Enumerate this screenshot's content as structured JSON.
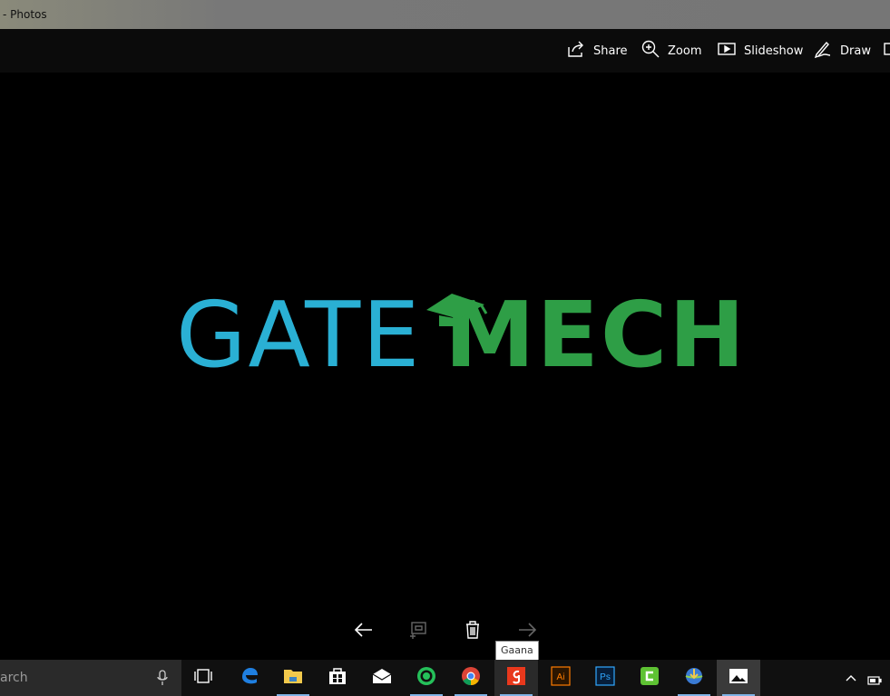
{
  "window": {
    "title": "- Photos"
  },
  "toolbar": {
    "share_label": "Share",
    "zoom_label": "Zoom",
    "slideshow_label": "Slideshow",
    "draw_label": "Draw"
  },
  "image": {
    "logo_left": "GATE",
    "logo_right": "MECH",
    "colors": {
      "gate": "#2ab0d4",
      "mech": "#2e9e46"
    }
  },
  "controls": {
    "icons": [
      "arrow-left-icon",
      "rotate-icon",
      "trash-icon",
      "arrow-right-icon"
    ]
  },
  "tooltip": {
    "text": "Gaana"
  },
  "taskbar": {
    "search_placeholder": "arch",
    "apps": [
      "task-view",
      "edge",
      "file-explorer",
      "store",
      "mail",
      "whatsapp",
      "chrome",
      "gaana",
      "illustrator",
      "photoshop",
      "camtasia",
      "internet-download-manager",
      "photos"
    ]
  }
}
